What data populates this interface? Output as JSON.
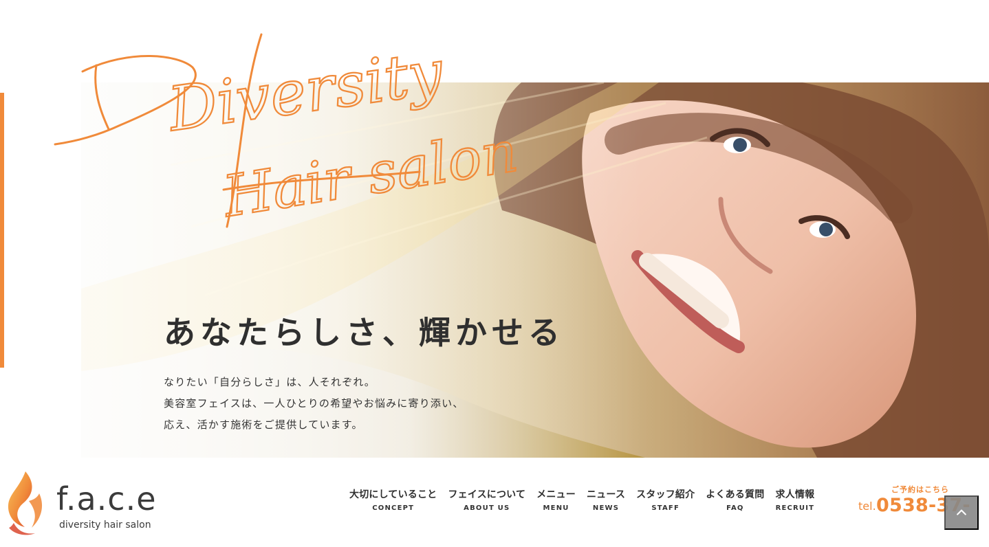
{
  "hero": {
    "script_line1": "Diversity",
    "script_line2": "Hair salon",
    "tagline": "あなたらしさ、輝かせる",
    "description": [
      "なりたい「自分らしさ」は、人それぞれ。",
      "美容室フェイスは、一人ひとりの希望やお悩みに寄り添い、",
      "応え、活かす施術をご提供しています。"
    ]
  },
  "brand": {
    "name": "f.a.c.e",
    "tagline": "diversity hair salon"
  },
  "nav": {
    "items": [
      {
        "jp": "大切にしていること",
        "en": "CONCEPT"
      },
      {
        "jp": "フェイスについて",
        "en": "ABOUT US"
      },
      {
        "jp": "メニュー",
        "en": "MENU"
      },
      {
        "jp": "ニュース",
        "en": "NEWS"
      },
      {
        "jp": "スタッフ紹介",
        "en": "STAFF"
      },
      {
        "jp": "よくある質問",
        "en": "FAQ"
      },
      {
        "jp": "求人情報",
        "en": "RECRUIT"
      }
    ]
  },
  "reserve": {
    "label": "ご予約はこちら",
    "tel_prefix": "tel.",
    "number": "0538-37-"
  },
  "colors": {
    "accent": "#f08a3a",
    "text": "#2f2f2f",
    "back_to_top": "#878787"
  },
  "icons": {
    "logo": "flame-logo-icon",
    "back_to_top": "chevron-up-icon"
  }
}
